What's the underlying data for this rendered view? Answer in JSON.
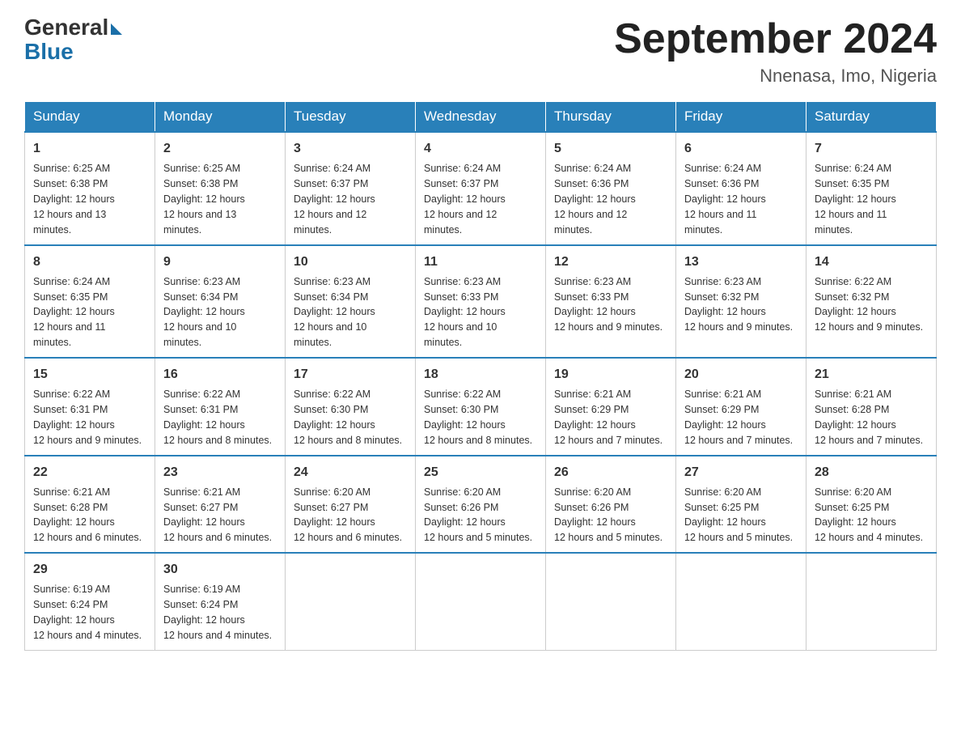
{
  "header": {
    "logo_general": "General",
    "logo_blue": "Blue",
    "month_title": "September 2024",
    "location": "Nnenasa, Imo, Nigeria"
  },
  "days_of_week": [
    "Sunday",
    "Monday",
    "Tuesday",
    "Wednesday",
    "Thursday",
    "Friday",
    "Saturday"
  ],
  "weeks": [
    [
      {
        "day": "1",
        "sunrise": "6:25 AM",
        "sunset": "6:38 PM",
        "daylight": "12 hours and 13 minutes."
      },
      {
        "day": "2",
        "sunrise": "6:25 AM",
        "sunset": "6:38 PM",
        "daylight": "12 hours and 13 minutes."
      },
      {
        "day": "3",
        "sunrise": "6:24 AM",
        "sunset": "6:37 PM",
        "daylight": "12 hours and 12 minutes."
      },
      {
        "day": "4",
        "sunrise": "6:24 AM",
        "sunset": "6:37 PM",
        "daylight": "12 hours and 12 minutes."
      },
      {
        "day": "5",
        "sunrise": "6:24 AM",
        "sunset": "6:36 PM",
        "daylight": "12 hours and 12 minutes."
      },
      {
        "day": "6",
        "sunrise": "6:24 AM",
        "sunset": "6:36 PM",
        "daylight": "12 hours and 11 minutes."
      },
      {
        "day": "7",
        "sunrise": "6:24 AM",
        "sunset": "6:35 PM",
        "daylight": "12 hours and 11 minutes."
      }
    ],
    [
      {
        "day": "8",
        "sunrise": "6:24 AM",
        "sunset": "6:35 PM",
        "daylight": "12 hours and 11 minutes."
      },
      {
        "day": "9",
        "sunrise": "6:23 AM",
        "sunset": "6:34 PM",
        "daylight": "12 hours and 10 minutes."
      },
      {
        "day": "10",
        "sunrise": "6:23 AM",
        "sunset": "6:34 PM",
        "daylight": "12 hours and 10 minutes."
      },
      {
        "day": "11",
        "sunrise": "6:23 AM",
        "sunset": "6:33 PM",
        "daylight": "12 hours and 10 minutes."
      },
      {
        "day": "12",
        "sunrise": "6:23 AM",
        "sunset": "6:33 PM",
        "daylight": "12 hours and 9 minutes."
      },
      {
        "day": "13",
        "sunrise": "6:23 AM",
        "sunset": "6:32 PM",
        "daylight": "12 hours and 9 minutes."
      },
      {
        "day": "14",
        "sunrise": "6:22 AM",
        "sunset": "6:32 PM",
        "daylight": "12 hours and 9 minutes."
      }
    ],
    [
      {
        "day": "15",
        "sunrise": "6:22 AM",
        "sunset": "6:31 PM",
        "daylight": "12 hours and 9 minutes."
      },
      {
        "day": "16",
        "sunrise": "6:22 AM",
        "sunset": "6:31 PM",
        "daylight": "12 hours and 8 minutes."
      },
      {
        "day": "17",
        "sunrise": "6:22 AM",
        "sunset": "6:30 PM",
        "daylight": "12 hours and 8 minutes."
      },
      {
        "day": "18",
        "sunrise": "6:22 AM",
        "sunset": "6:30 PM",
        "daylight": "12 hours and 8 minutes."
      },
      {
        "day": "19",
        "sunrise": "6:21 AM",
        "sunset": "6:29 PM",
        "daylight": "12 hours and 7 minutes."
      },
      {
        "day": "20",
        "sunrise": "6:21 AM",
        "sunset": "6:29 PM",
        "daylight": "12 hours and 7 minutes."
      },
      {
        "day": "21",
        "sunrise": "6:21 AM",
        "sunset": "6:28 PM",
        "daylight": "12 hours and 7 minutes."
      }
    ],
    [
      {
        "day": "22",
        "sunrise": "6:21 AM",
        "sunset": "6:28 PM",
        "daylight": "12 hours and 6 minutes."
      },
      {
        "day": "23",
        "sunrise": "6:21 AM",
        "sunset": "6:27 PM",
        "daylight": "12 hours and 6 minutes."
      },
      {
        "day": "24",
        "sunrise": "6:20 AM",
        "sunset": "6:27 PM",
        "daylight": "12 hours and 6 minutes."
      },
      {
        "day": "25",
        "sunrise": "6:20 AM",
        "sunset": "6:26 PM",
        "daylight": "12 hours and 5 minutes."
      },
      {
        "day": "26",
        "sunrise": "6:20 AM",
        "sunset": "6:26 PM",
        "daylight": "12 hours and 5 minutes."
      },
      {
        "day": "27",
        "sunrise": "6:20 AM",
        "sunset": "6:25 PM",
        "daylight": "12 hours and 5 minutes."
      },
      {
        "day": "28",
        "sunrise": "6:20 AM",
        "sunset": "6:25 PM",
        "daylight": "12 hours and 4 minutes."
      }
    ],
    [
      {
        "day": "29",
        "sunrise": "6:19 AM",
        "sunset": "6:24 PM",
        "daylight": "12 hours and 4 minutes."
      },
      {
        "day": "30",
        "sunrise": "6:19 AM",
        "sunset": "6:24 PM",
        "daylight": "12 hours and 4 minutes."
      },
      null,
      null,
      null,
      null,
      null
    ]
  ]
}
